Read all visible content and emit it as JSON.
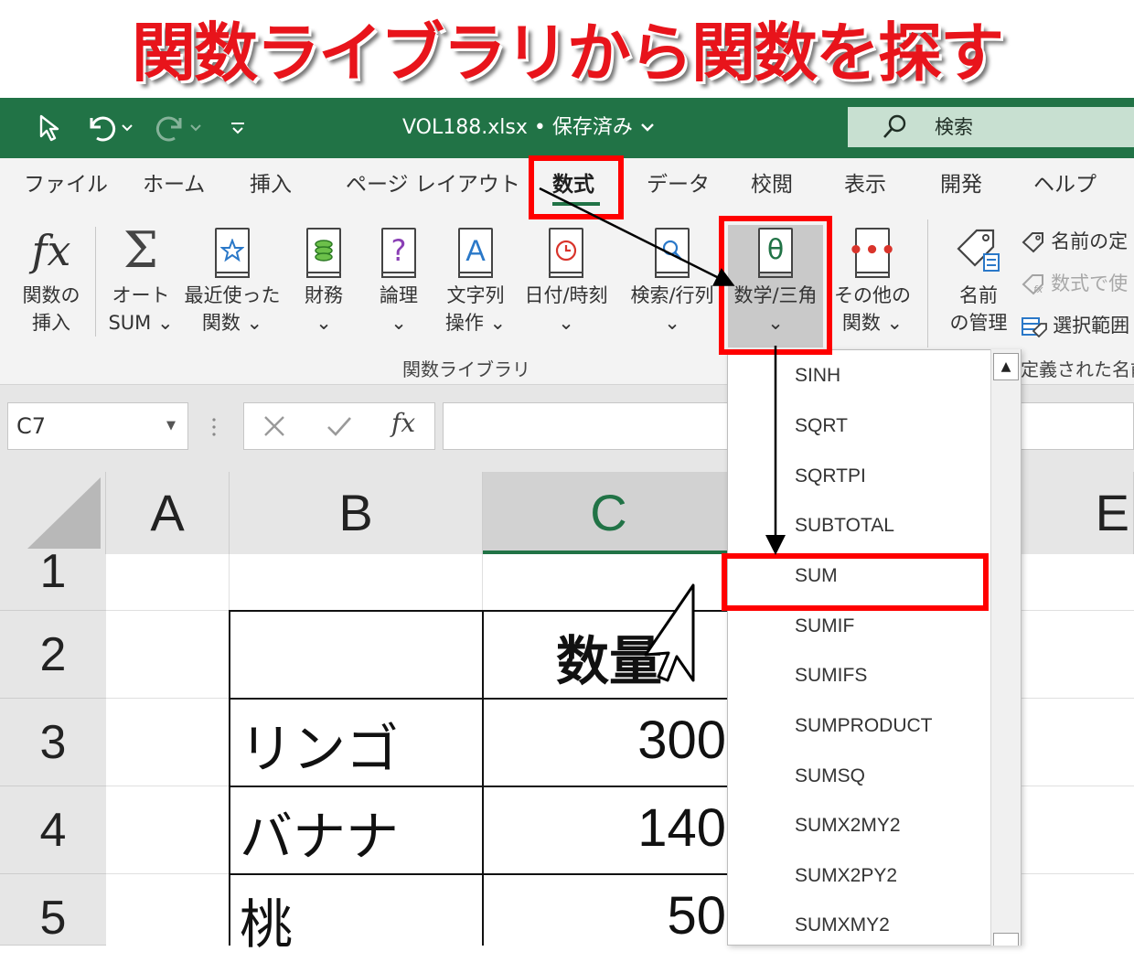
{
  "banner": {
    "title": "関数ライブラリから関数を探す"
  },
  "titlebar": {
    "filename": "VOL188.xlsx",
    "save_state": "• 保存済み",
    "search_label": "検索"
  },
  "tabs": [
    {
      "label": "ファイル"
    },
    {
      "label": "ホーム"
    },
    {
      "label": "挿入"
    },
    {
      "label": "ページ レイアウト"
    },
    {
      "label": "数式"
    },
    {
      "label": "データ"
    },
    {
      "label": "校閲"
    },
    {
      "label": "表示"
    },
    {
      "label": "開発"
    },
    {
      "label": "ヘルプ"
    }
  ],
  "ribbon": {
    "insert_function": {
      "line1": "関数の",
      "line2": "挿入"
    },
    "autosum": {
      "line1": "オート",
      "line2": "SUM ⌄"
    },
    "recent": {
      "line1": "最近使った",
      "line2": "関数 ⌄"
    },
    "financial": {
      "line1": "財務",
      "line2": "⌄"
    },
    "logical": {
      "line1": "論理",
      "line2": "⌄"
    },
    "text": {
      "line1": "文字列",
      "line2": "操作 ⌄"
    },
    "datetime": {
      "line1": "日付/時刻",
      "line2": "⌄"
    },
    "lookup": {
      "line1": "検索/行列",
      "line2": "⌄"
    },
    "math": {
      "line1": "数学/三角",
      "line2": "⌄"
    },
    "more": {
      "line1": "その他の",
      "line2": "関数 ⌄"
    },
    "name_manager": {
      "line1": "名前",
      "line2": "の管理"
    },
    "define_name": "名前の定",
    "use_in_formula": "数式で使",
    "create_from_selection": "選択範囲",
    "group_function_library": "関数ライブラリ",
    "group_defined_names": "定義された名前"
  },
  "formula_bar": {
    "name_box": "C7"
  },
  "grid": {
    "columns": [
      "A",
      "B",
      "C",
      "E"
    ],
    "rows": [
      "1",
      "2",
      "3",
      "4",
      "5"
    ],
    "header_cell": "数量",
    "items": [
      {
        "name": "リンゴ",
        "qty": "300"
      },
      {
        "name": "バナナ",
        "qty": "140"
      },
      {
        "name": "桃",
        "qty": "50"
      }
    ]
  },
  "dropdown": {
    "items": [
      "SINH",
      "SQRT",
      "SQRTPI",
      "SUBTOTAL",
      "SUM",
      "SUMIF",
      "SUMIFS",
      "SUMPRODUCT",
      "SUMSQ",
      "SUMX2MY2",
      "SUMX2PY2",
      "SUMXMY2"
    ],
    "selected": "SUM"
  },
  "colors": {
    "excel_green": "#217346",
    "highlight_red": "#ff0000",
    "banner_red": "#e8141b"
  }
}
